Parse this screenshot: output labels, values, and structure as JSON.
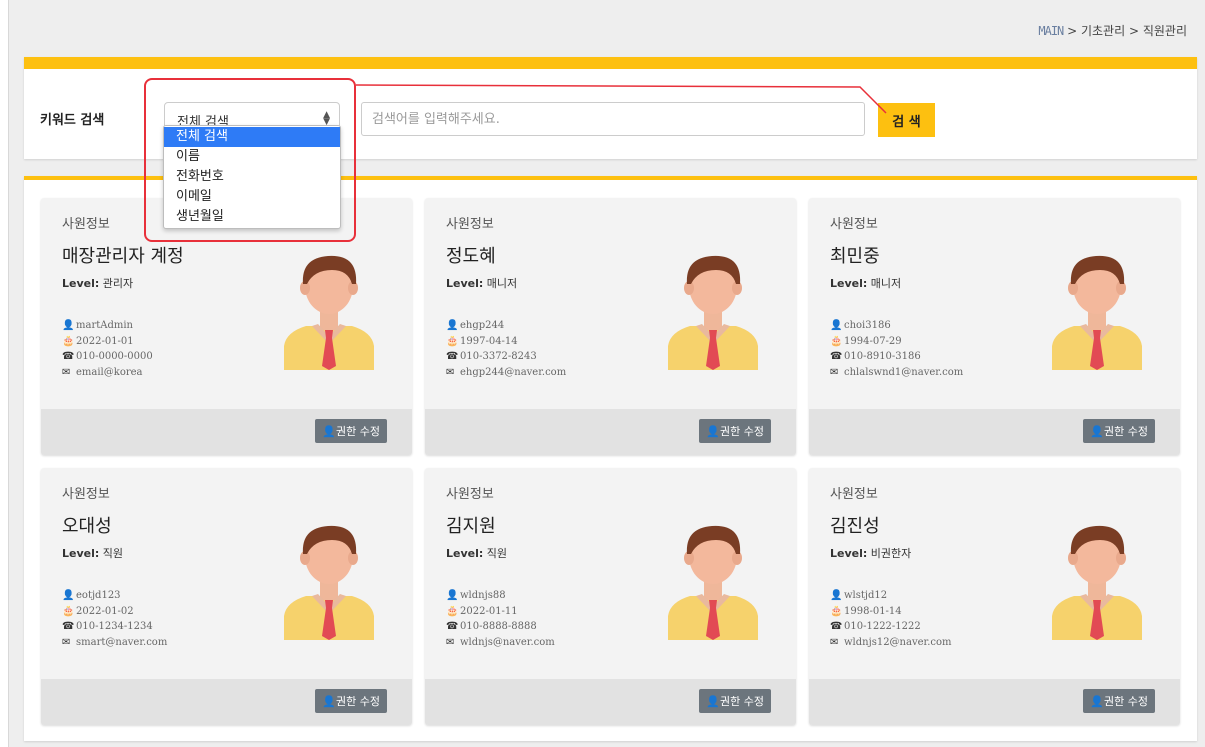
{
  "breadcrumb": {
    "root": "MAIN",
    "sep1": " > ",
    "level1": "기초관리",
    "sep2": " > ",
    "level2": "직원관리"
  },
  "search": {
    "label": "키워드 검색",
    "select_value": "전체 검색",
    "placeholder": "검색어를 입력해주세요.",
    "button": "검 색",
    "options": [
      "전체 검색",
      "이름",
      "전화번호",
      "이메일",
      "생년월일"
    ]
  },
  "cards": [
    {
      "title": "사원정보",
      "name": "매장관리자 계정",
      "level_label": "Level:",
      "level": "관리자",
      "id": "martAdmin",
      "date": "2022-01-01",
      "phone": "010-0000-0000",
      "email": "email@korea",
      "button": "권한 수정"
    },
    {
      "title": "사원정보",
      "name": "정도혜",
      "level_label": "Level:",
      "level": "매니저",
      "id": "ehgp244",
      "date": "1997-04-14",
      "phone": "010-3372-8243",
      "email": "ehgp244@naver.com",
      "button": "권한 수정"
    },
    {
      "title": "사원정보",
      "name": "최민중",
      "level_label": "Level:",
      "level": "매니저",
      "id": "choi3186",
      "date": "1994-07-29",
      "phone": "010-8910-3186",
      "email": "chlalswnd1@naver.com",
      "button": "권한 수정"
    },
    {
      "title": "사원정보",
      "name": "오대성",
      "level_label": "Level:",
      "level": "직원",
      "id": "eotjd123",
      "date": "2022-01-02",
      "phone": "010-1234-1234",
      "email": "smart@naver.com",
      "button": "권한 수정"
    },
    {
      "title": "사원정보",
      "name": "김지원",
      "level_label": "Level:",
      "level": "직원",
      "id": "wldnjs88",
      "date": "2022-01-11",
      "phone": "010-8888-8888",
      "email": "wldnjs@naver.com",
      "button": "권한 수정"
    },
    {
      "title": "사원정보",
      "name": "김진성",
      "level_label": "Level:",
      "level": "비권한자",
      "id": "wlstjd12",
      "date": "1998-01-14",
      "phone": "010-1222-1222",
      "email": "wldnjs12@naver.com",
      "button": "권한 수정"
    }
  ],
  "icons": {
    "user": "user-icon",
    "birthday": "birthday-cake-icon",
    "phone": "phone-icon",
    "email": "envelope-icon",
    "avatar": "employee-avatar-icon",
    "select": "sort-arrows-icon"
  },
  "colors": {
    "accent": "#fdc010",
    "dropdown_selected": "#2e7bf6",
    "annotation": "#e8303a",
    "button_gray": "#6c757d"
  }
}
